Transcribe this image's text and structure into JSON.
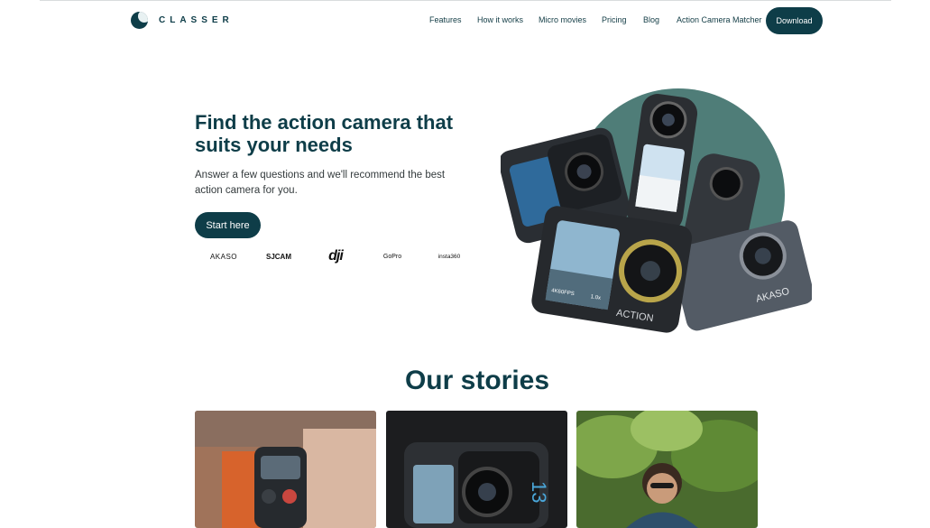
{
  "brand": {
    "name": "CLASSER"
  },
  "nav": {
    "links": [
      "Features",
      "How it works",
      "Micro movies",
      "Pricing",
      "Blog",
      "Action Camera Matcher"
    ],
    "download_label": "Download"
  },
  "hero": {
    "title": "Find the action camera that suits your needs",
    "subtitle": "Answer a few questions and we'll recommend the best action camera for you.",
    "cta_label": "Start here"
  },
  "brand_logos": [
    "AKASO",
    "SJCAM",
    "dji",
    "GoPro",
    "insta360"
  ],
  "hero_image_labels": {
    "camera_badge": "ACTION",
    "akaso_badge": "AKASO",
    "rec_time": "4K60FPS",
    "zoom": "1.0x"
  },
  "stories": {
    "title": "Our stories",
    "cards": [
      {
        "icon": "smartwatch-photo"
      },
      {
        "icon": "action-camera-photo",
        "badge": "13"
      },
      {
        "icon": "portrait-photo"
      }
    ]
  },
  "colors": {
    "primary": "#0e3d48",
    "circle": "#4f7d78",
    "background": "#ffffff"
  }
}
